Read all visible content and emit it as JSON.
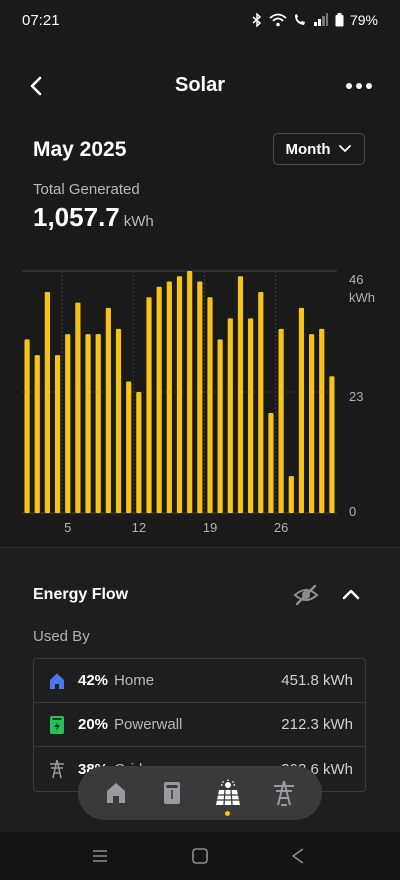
{
  "status": {
    "time": "07:21",
    "battery": "79%"
  },
  "header": {
    "title": "Solar"
  },
  "period": {
    "label": "May 2025",
    "range_button": "Month"
  },
  "total": {
    "label": "Total Generated",
    "value": "1,057.7",
    "unit": "kWh"
  },
  "chart_data": {
    "type": "bar",
    "x": [
      1,
      2,
      3,
      4,
      5,
      6,
      7,
      8,
      9,
      10,
      11,
      12,
      13,
      14,
      15,
      16,
      17,
      18,
      19,
      20,
      21,
      22,
      23,
      24,
      25,
      26,
      27,
      28,
      29,
      30,
      31
    ],
    "values": [
      33,
      30,
      42,
      30,
      34,
      40,
      34,
      34,
      39,
      35,
      25,
      23,
      41,
      43,
      44,
      45,
      46,
      44,
      41,
      33,
      37,
      45,
      37,
      42,
      19,
      35,
      7,
      39,
      34,
      35,
      26
    ],
    "x_tick_labels": [
      "5",
      "12",
      "19",
      "26"
    ],
    "y_tick_labels": [
      "46",
      "23",
      "0"
    ],
    "y_unit": "kWh",
    "ylim": [
      0,
      46
    ],
    "bar_color": "#f6c31b"
  },
  "energy_flow": {
    "title": "Energy Flow",
    "used_by_label": "Used By",
    "rows": [
      {
        "pct": "42%",
        "name": "Home",
        "value": "451.8 kWh",
        "icon": "home-icon"
      },
      {
        "pct": "20%",
        "name": "Powerwall",
        "value": "212.3 kWh",
        "icon": "powerwall-icon"
      },
      {
        "pct": "38%",
        "name": "Grid",
        "value": "393.6 kWh",
        "icon": "grid-tower-icon"
      }
    ]
  },
  "colors": {
    "accent": "#f6c31b",
    "home_icon": "#4a78e8",
    "powerwall_icon": "#2ebd5b"
  }
}
